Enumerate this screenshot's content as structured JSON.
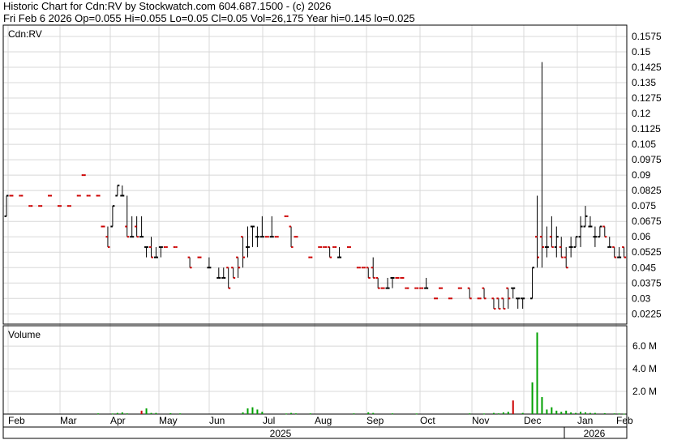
{
  "header": {
    "line1": "Historic Chart for Cdn:RV by Stockwatch.com 604.687.1500 - (c) 2026",
    "line2": "Fri Feb  6 2026   Op=0.055   Hi=0.055   Lo=0.05   Cl=0.05   Vol=26,175   Year hi=0.145   lo=0.025"
  },
  "colors": {
    "up": "#000000",
    "down": "#cc0000",
    "grid": "#d8d8d8",
    "volume": "#00a000",
    "volume_down": "#cc0000"
  },
  "chart_data": [
    {
      "type": "ohlc",
      "title": "Cdn:RV",
      "yticks": [
        "0.1575",
        "0.15",
        "0.1425",
        "0.135",
        "0.1275",
        "0.12",
        "0.1125",
        "0.105",
        "0.0975",
        "0.09",
        "0.0825",
        "0.075",
        "0.0675",
        "0.06",
        "0.0525",
        "0.045",
        "0.0375",
        "0.03",
        "0.0225"
      ],
      "ylim": [
        0.0175,
        0.163
      ],
      "grid": true,
      "months": [
        "Feb",
        "Mar",
        "Apr",
        "May",
        "Jun",
        "Jul",
        "Aug",
        "Sep",
        "Oct",
        "Nov",
        "Dec",
        "Jan",
        "Feb"
      ],
      "years": [
        "2025",
        "2026"
      ],
      "bars": [
        [
          0,
          0.07,
          0.08,
          0.07,
          0.08
        ],
        [
          1,
          0.08,
          0.08,
          0.08,
          0.08
        ],
        [
          3,
          0.08,
          0.08,
          0.08,
          0.08
        ],
        [
          5,
          0.075,
          0.075,
          0.075,
          0.075
        ],
        [
          7,
          0.075,
          0.075,
          0.075,
          0.075
        ],
        [
          9,
          0.08,
          0.08,
          0.08,
          0.08
        ],
        [
          11,
          0.075,
          0.075,
          0.075,
          0.075
        ],
        [
          13,
          0.075,
          0.075,
          0.075,
          0.075
        ],
        [
          15,
          0.08,
          0.08,
          0.08,
          0.08
        ],
        [
          16,
          0.09,
          0.09,
          0.09,
          0.09
        ],
        [
          17,
          0.08,
          0.08,
          0.08,
          0.08
        ],
        [
          19,
          0.08,
          0.08,
          0.08,
          0.08
        ],
        [
          20,
          0.065,
          0.065,
          0.065,
          0.065
        ],
        [
          21,
          0.06,
          0.065,
          0.055,
          0.055
        ],
        [
          22,
          0.065,
          0.075,
          0.065,
          0.075
        ],
        [
          23,
          0.08,
          0.085,
          0.08,
          0.085
        ],
        [
          24,
          0.08,
          0.085,
          0.08,
          0.08
        ],
        [
          25,
          0.065,
          0.08,
          0.06,
          0.06
        ],
        [
          26,
          0.06,
          0.07,
          0.06,
          0.06
        ],
        [
          27,
          0.065,
          0.07,
          0.06,
          0.06
        ],
        [
          28,
          0.06,
          0.07,
          0.06,
          0.06
        ],
        [
          29,
          0.055,
          0.055,
          0.05,
          0.055
        ],
        [
          30,
          0.055,
          0.06,
          0.05,
          0.05
        ],
        [
          31,
          0.05,
          0.055,
          0.05,
          0.05
        ],
        [
          32,
          0.055,
          0.055,
          0.05,
          0.055
        ],
        [
          33,
          0.055,
          0.055,
          0.055,
          0.055
        ],
        [
          35,
          0.055,
          0.055,
          0.055,
          0.055
        ],
        [
          38,
          0.05,
          0.05,
          0.045,
          0.045
        ],
        [
          40,
          0.05,
          0.05,
          0.05,
          0.05
        ],
        [
          42,
          0.045,
          0.05,
          0.045,
          0.045
        ],
        [
          44,
          0.04,
          0.045,
          0.04,
          0.04
        ],
        [
          45,
          0.04,
          0.045,
          0.04,
          0.04
        ],
        [
          46,
          0.045,
          0.045,
          0.035,
          0.035
        ],
        [
          47,
          0.045,
          0.045,
          0.04,
          0.04
        ],
        [
          48,
          0.05,
          0.05,
          0.04,
          0.045
        ],
        [
          49,
          0.06,
          0.06,
          0.045,
          0.05
        ],
        [
          50,
          0.055,
          0.065,
          0.05,
          0.055
        ],
        [
          51,
          0.065,
          0.065,
          0.055,
          0.065
        ],
        [
          52,
          0.06,
          0.065,
          0.055,
          0.06
        ],
        [
          53,
          0.06,
          0.07,
          0.06,
          0.06
        ],
        [
          54,
          0.06,
          0.06,
          0.06,
          0.06
        ],
        [
          55,
          0.06,
          0.07,
          0.06,
          0.06
        ],
        [
          56,
          0.06,
          0.06,
          0.06,
          0.06
        ],
        [
          58,
          0.07,
          0.07,
          0.07,
          0.07
        ],
        [
          59,
          0.065,
          0.065,
          0.055,
          0.055
        ],
        [
          60,
          0.06,
          0.06,
          0.06,
          0.06
        ],
        [
          63,
          0.05,
          0.05,
          0.05,
          0.05
        ],
        [
          65,
          0.055,
          0.055,
          0.055,
          0.055
        ],
        [
          66,
          0.055,
          0.055,
          0.055,
          0.055
        ],
        [
          67,
          0.055,
          0.055,
          0.05,
          0.05
        ],
        [
          68,
          0.055,
          0.055,
          0.055,
          0.055
        ],
        [
          69,
          0.05,
          0.055,
          0.05,
          0.05
        ],
        [
          71,
          0.055,
          0.055,
          0.055,
          0.055
        ],
        [
          73,
          0.045,
          0.045,
          0.045,
          0.045
        ],
        [
          74,
          0.045,
          0.045,
          0.045,
          0.045
        ],
        [
          75,
          0.045,
          0.045,
          0.04,
          0.04
        ],
        [
          76,
          0.045,
          0.05,
          0.04,
          0.04
        ],
        [
          77,
          0.04,
          0.04,
          0.035,
          0.035
        ],
        [
          78,
          0.035,
          0.035,
          0.035,
          0.035
        ],
        [
          79,
          0.035,
          0.04,
          0.035,
          0.035
        ],
        [
          80,
          0.04,
          0.04,
          0.035,
          0.04
        ],
        [
          81,
          0.04,
          0.04,
          0.04,
          0.04
        ],
        [
          82,
          0.04,
          0.04,
          0.04,
          0.04
        ],
        [
          83,
          0.035,
          0.035,
          0.035,
          0.035
        ],
        [
          85,
          0.035,
          0.035,
          0.035,
          0.035
        ],
        [
          86,
          0.035,
          0.035,
          0.035,
          0.035
        ],
        [
          87,
          0.035,
          0.04,
          0.035,
          0.035
        ],
        [
          89,
          0.03,
          0.03,
          0.03,
          0.03
        ],
        [
          90,
          0.035,
          0.035,
          0.035,
          0.035
        ],
        [
          92,
          0.03,
          0.03,
          0.03,
          0.03
        ],
        [
          94,
          0.035,
          0.035,
          0.035,
          0.035
        ],
        [
          96,
          0.035,
          0.035,
          0.03,
          0.03
        ],
        [
          98,
          0.03,
          0.03,
          0.03,
          0.03
        ],
        [
          99,
          0.035,
          0.035,
          0.03,
          0.03
        ],
        [
          101,
          0.03,
          0.03,
          0.025,
          0.025
        ],
        [
          102,
          0.03,
          0.03,
          0.025,
          0.025
        ],
        [
          103,
          0.03,
          0.03,
          0.025,
          0.025
        ],
        [
          104,
          0.035,
          0.035,
          0.025,
          0.03
        ],
        [
          105,
          0.035,
          0.035,
          0.03,
          0.035
        ],
        [
          106,
          0.03,
          0.03,
          0.025,
          0.03
        ],
        [
          107,
          0.03,
          0.03,
          0.025,
          0.03
        ],
        [
          109,
          0.03,
          0.045,
          0.03,
          0.045
        ],
        [
          110,
          0.06,
          0.08,
          0.045,
          0.05
        ],
        [
          111,
          0.06,
          0.145,
          0.045,
          0.055
        ],
        [
          112,
          0.055,
          0.065,
          0.05,
          0.055
        ],
        [
          113,
          0.06,
          0.07,
          0.055,
          0.055
        ],
        [
          114,
          0.055,
          0.065,
          0.05,
          0.06
        ],
        [
          115,
          0.055,
          0.06,
          0.05,
          0.05
        ],
        [
          116,
          0.05,
          0.055,
          0.045,
          0.045
        ],
        [
          117,
          0.055,
          0.06,
          0.05,
          0.055
        ],
        [
          118,
          0.055,
          0.06,
          0.055,
          0.06
        ],
        [
          119,
          0.06,
          0.07,
          0.055,
          0.065
        ],
        [
          120,
          0.065,
          0.075,
          0.065,
          0.07
        ],
        [
          121,
          0.065,
          0.07,
          0.065,
          0.065
        ],
        [
          122,
          0.06,
          0.065,
          0.055,
          0.06
        ],
        [
          123,
          0.06,
          0.065,
          0.06,
          0.065
        ],
        [
          124,
          0.065,
          0.065,
          0.06,
          0.06
        ],
        [
          125,
          0.055,
          0.06,
          0.055,
          0.055
        ],
        [
          126,
          0.055,
          0.055,
          0.05,
          0.05
        ],
        [
          127,
          0.05,
          0.055,
          0.05,
          0.05
        ],
        [
          128,
          0.055,
          0.055,
          0.05,
          0.05
        ]
      ]
    },
    {
      "type": "bar",
      "title": "Volume",
      "yticks": [
        "6.0 M",
        "4.0 M",
        "2.0 M"
      ],
      "ylim": [
        0,
        7.8
      ],
      "units": "M",
      "bars": [
        [
          19,
          0.06
        ],
        [
          22,
          0.05
        ],
        [
          23,
          0.1
        ],
        [
          24,
          0.15
        ],
        [
          25,
          0.06
        ],
        [
          28,
          0.3
        ],
        [
          29,
          0.5
        ],
        [
          30,
          0.1
        ],
        [
          31,
          0.1
        ],
        [
          34,
          0.08
        ],
        [
          36,
          0.06
        ],
        [
          49,
          0.15
        ],
        [
          50,
          0.5
        ],
        [
          51,
          0.6
        ],
        [
          52,
          0.4
        ],
        [
          53,
          0.2
        ],
        [
          58,
          0.05
        ],
        [
          59,
          0.1
        ],
        [
          60,
          0.06
        ],
        [
          63,
          0.06
        ],
        [
          72,
          0.06
        ],
        [
          75,
          0.15
        ],
        [
          76,
          0.1
        ],
        [
          80,
          0.06
        ],
        [
          85,
          0.05
        ],
        [
          96,
          0.06
        ],
        [
          99,
          0.05
        ],
        [
          101,
          0.1
        ],
        [
          102,
          0.06
        ],
        [
          103,
          0.15
        ],
        [
          104,
          0.2
        ],
        [
          105,
          1.2
        ],
        [
          107,
          0.1
        ],
        [
          109,
          2.8
        ],
        [
          110,
          7.2
        ],
        [
          111,
          1.5
        ],
        [
          112,
          0.4
        ],
        [
          113,
          0.6
        ],
        [
          114,
          0.3
        ],
        [
          115,
          0.2
        ],
        [
          116,
          0.3
        ],
        [
          117,
          0.15
        ],
        [
          118,
          0.1
        ],
        [
          119,
          0.2
        ],
        [
          120,
          0.15
        ],
        [
          121,
          0.1
        ],
        [
          122,
          0.1
        ],
        [
          124,
          0.08
        ],
        [
          126,
          0.06
        ],
        [
          127,
          0.05
        ],
        [
          128,
          0.03
        ]
      ]
    }
  ]
}
